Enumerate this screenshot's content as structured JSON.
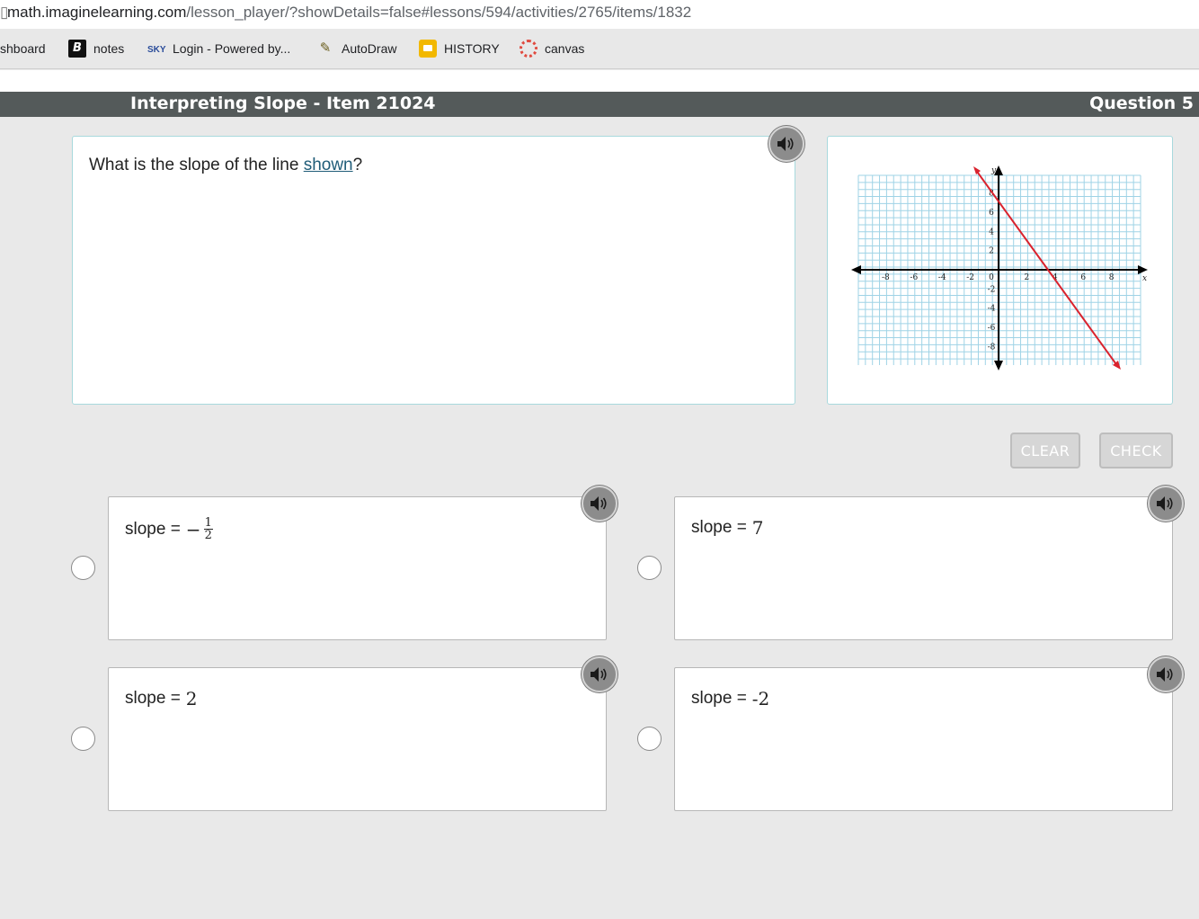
{
  "browser": {
    "url_host": "math.imaginelearning.com",
    "url_path": "/lesson_player/?showDetails=false#lessons/594/activities/2765/items/1832",
    "bookmarks": [
      {
        "label": "shboard",
        "icon": "none"
      },
      {
        "label": "notes",
        "icon": "b-logo-icon"
      },
      {
        "label": "Login - Powered by...",
        "icon": "sky-logo-icon"
      },
      {
        "label": "AutoDraw",
        "icon": "autodraw-pencil-icon"
      },
      {
        "label": "HISTORY",
        "icon": "slides-icon"
      },
      {
        "label": "canvas",
        "icon": "canvas-logo-icon"
      }
    ]
  },
  "header": {
    "title": "Interpreting Slope - Item 21024",
    "question": "Question 5"
  },
  "question": {
    "text_before": "What is the slope of the line ",
    "link_text": "shown",
    "text_after": "?"
  },
  "graph": {
    "x_axis_label": "x",
    "y_axis_label": "y",
    "x_ticks": [
      "-8",
      "-6",
      "-4",
      "-2",
      "0",
      "2",
      "4",
      "6",
      "8"
    ],
    "y_ticks": [
      "8",
      "6",
      "4",
      "2",
      "-2",
      "-4",
      "-6",
      "-8"
    ],
    "line_color": "#d9232e",
    "grid_color": "#9fd3e6"
  },
  "buttons": {
    "clear": "CLEAR",
    "check": "CHECK"
  },
  "choices": {
    "a": {
      "prefix": "slope = ",
      "sign": "−",
      "numerator": "1",
      "denominator": "2"
    },
    "b": {
      "prefix": "slope = ",
      "value": "7"
    },
    "c": {
      "prefix": "slope = ",
      "value": "2"
    },
    "d": {
      "prefix": "slope = ",
      "value": "-2"
    }
  }
}
